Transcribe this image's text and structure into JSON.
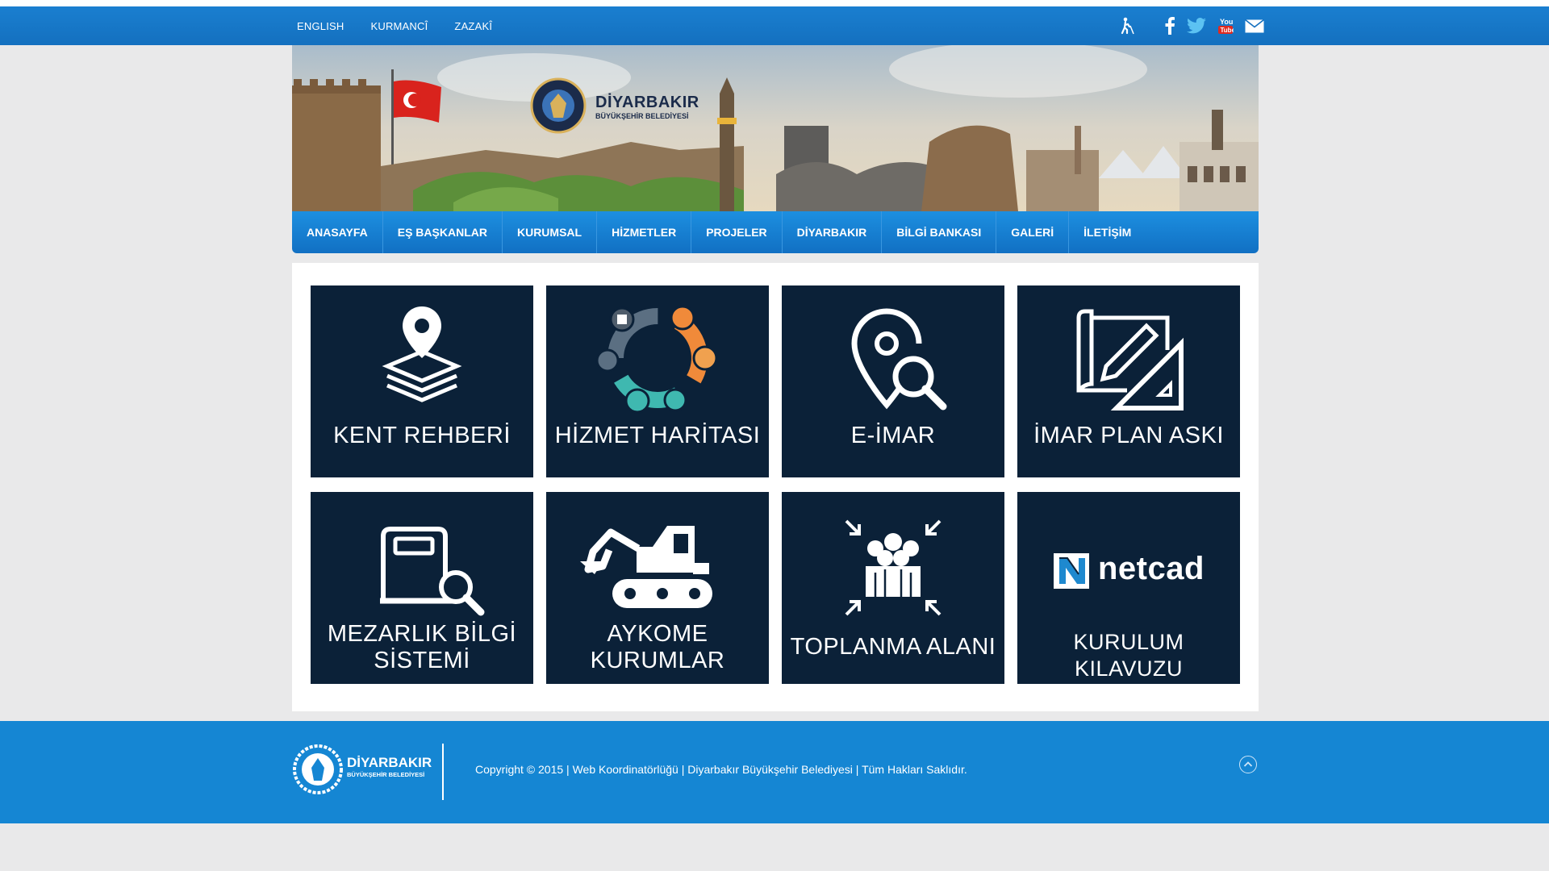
{
  "topbar": {
    "languages": [
      "ENGLISH",
      "KURMANCÎ",
      "ZAZAKÎ"
    ],
    "social_icons": [
      "accessibility-icon",
      "facebook-icon",
      "twitter-icon",
      "youtube-icon",
      "mail-icon"
    ]
  },
  "banner": {
    "logo_title": "DİYARBAKIR",
    "logo_subtitle": "BÜYÜKŞEHİR BELEDİYESİ"
  },
  "nav": [
    "ANASAYFA",
    "EŞ BAŞKANLAR",
    "KURUMSAL",
    "HİZMETLER",
    "PROJELER",
    "DİYARBAKIR",
    "BİLGİ BANKASI",
    "GALERİ",
    "İLETİŞİM"
  ],
  "tiles": [
    {
      "label": "KENT REHBERİ",
      "icon": "map-pin-layers-icon"
    },
    {
      "label": "HİZMET HARİTASI",
      "icon": "service-ring-icon"
    },
    {
      "label": "E-İMAR",
      "icon": "location-search-icon"
    },
    {
      "label": "İMAR PLAN ASKI",
      "icon": "blueprint-pencil-icon"
    },
    {
      "label_line1": "MEZARLIK BİLGİ",
      "label_line2": "SİSTEMİ",
      "icon": "grave-search-icon"
    },
    {
      "label_line1": "AYKOME",
      "label_line2": "KURUMLAR",
      "icon": "excavator-icon"
    },
    {
      "label": "TOPLANMA ALANI",
      "icon": "assembly-people-icon"
    },
    {
      "brand": "netcad",
      "label": "KURULUM KILAVUZU",
      "icon": "netcad-logo-icon"
    }
  ],
  "footer": {
    "logo_title": "DİYARBAKIR",
    "logo_subtitle": "BÜYÜKŞEHİR BELEDİYESİ",
    "copyright": "Copyright © 2015 | Web Koordinatörlüğü | Diyarbakır Büyükşehir Belediyesi | Tüm Hakları Saklıdır."
  },
  "colors": {
    "topbar": "#1470bf",
    "tile": "#0b2138",
    "footer": "#1586d3",
    "accent_orange": "#f08a3a",
    "accent_teal": "#3fb8b0"
  }
}
